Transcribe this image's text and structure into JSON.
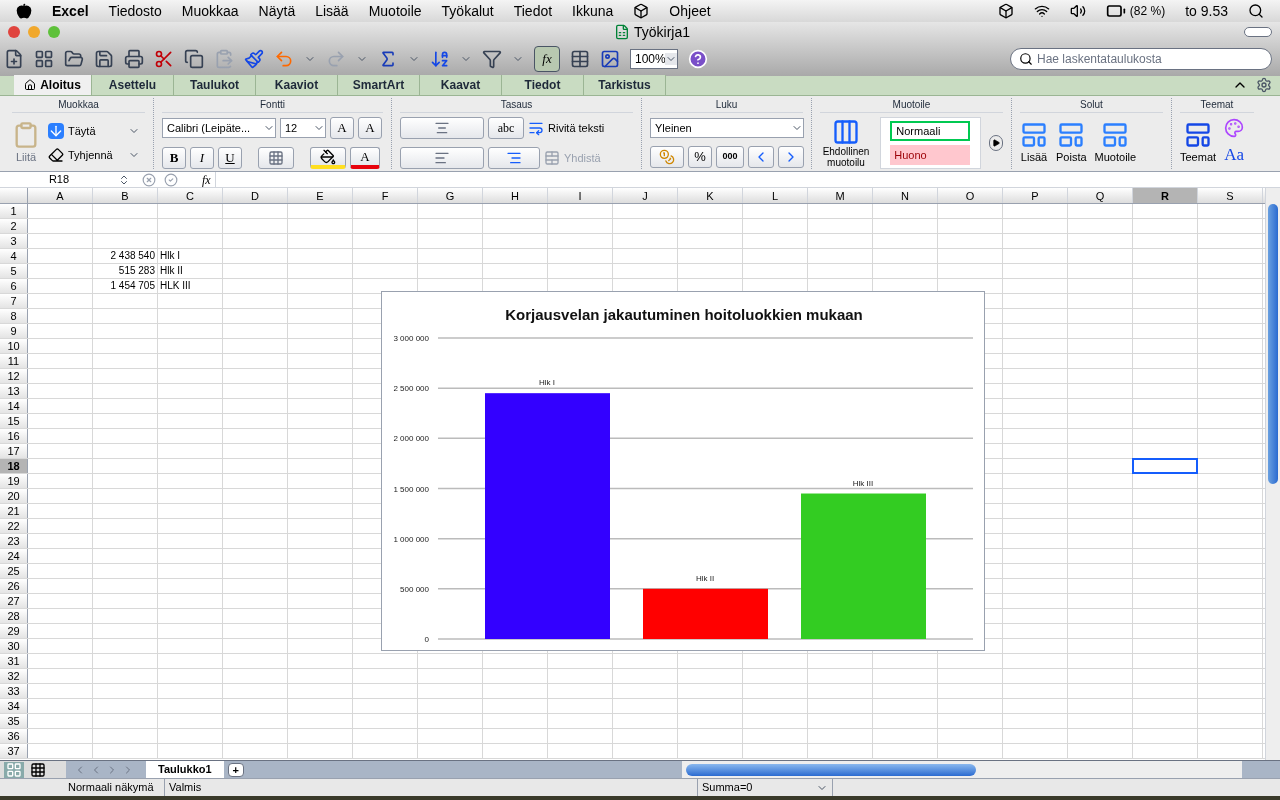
{
  "menubar": {
    "app": "Excel",
    "items": [
      "Tiedosto",
      "Muokkaa",
      "Näytä",
      "Lisää",
      "Muotoile",
      "Työkalut",
      "Tiedot",
      "Ikkuna",
      "Ohjeet"
    ],
    "battery": "(82 %)",
    "clock": "to 9.53"
  },
  "window": {
    "title": "Työkirja1"
  },
  "toolbar": {
    "zoom": "100%",
    "search_placeholder": "Hae laskentataulukosta",
    "formula_builder": "fx",
    "formula_builder_on": true
  },
  "ribbon_tabs": [
    {
      "label": "Aloitus",
      "selected": true
    },
    {
      "label": "Asettelu",
      "selected": false
    },
    {
      "label": "Taulukot",
      "selected": false
    },
    {
      "label": "Kaaviot",
      "selected": false
    },
    {
      "label": "SmartArt",
      "selected": false
    },
    {
      "label": "Kaavat",
      "selected": false
    },
    {
      "label": "Tiedot",
      "selected": false
    },
    {
      "label": "Tarkistus",
      "selected": false
    }
  ],
  "ribbon": {
    "muokkaa": {
      "title": "Muokkaa",
      "paste": "Liitä",
      "fill": "Täytä",
      "clear": "Tyhjennä"
    },
    "fontti": {
      "title": "Fontti",
      "font": "Calibri (Leipäte...",
      "size": "12",
      "bold": "B",
      "italic": "I",
      "underline": "U",
      "grow": "A",
      "shrink": "A",
      "font_color_letter": "A"
    },
    "tasaus": {
      "title": "Tasaus",
      "orientation": "abc",
      "wrap": "Rivitä teksti",
      "merge": "Yhdistä",
      "merge_disabled": true
    },
    "luku": {
      "title": "Luku",
      "format": "Yleinen",
      "percent": "%",
      "thousands": "000"
    },
    "muotoile": {
      "title": "Muotoile",
      "conditional": "Ehdollinen muotoilu",
      "styles": [
        {
          "label": "Normaali",
          "kind": "normal"
        },
        {
          "label": "Huono",
          "kind": "bad"
        }
      ]
    },
    "solut": {
      "title": "Solut",
      "buttons": [
        "Lisää",
        "Poista",
        "Muotoile"
      ]
    },
    "teemat": {
      "title": "Teemat",
      "themes": "Teemat",
      "fonts": "Aa"
    }
  },
  "formula_bar": {
    "name_box": "R18",
    "fx": "fx"
  },
  "columns": [
    {
      "label": "A",
      "selected": false
    },
    {
      "label": "B",
      "selected": false
    },
    {
      "label": "C",
      "selected": false
    },
    {
      "label": "D",
      "selected": false
    },
    {
      "label": "E",
      "selected": false
    },
    {
      "label": "F",
      "selected": false
    },
    {
      "label": "G",
      "selected": false
    },
    {
      "label": "H",
      "selected": false
    },
    {
      "label": "I",
      "selected": false
    },
    {
      "label": "J",
      "selected": false
    },
    {
      "label": "K",
      "selected": false
    },
    {
      "label": "L",
      "selected": false
    },
    {
      "label": "M",
      "selected": false
    },
    {
      "label": "N",
      "selected": false
    },
    {
      "label": "O",
      "selected": false
    },
    {
      "label": "P",
      "selected": false
    },
    {
      "label": "Q",
      "selected": false
    },
    {
      "label": "R",
      "selected": true
    },
    {
      "label": "S",
      "selected": false
    }
  ],
  "rows": [
    {
      "label": "1",
      "selected": false
    },
    {
      "label": "2",
      "selected": false
    },
    {
      "label": "3",
      "selected": false
    },
    {
      "label": "4",
      "selected": false,
      "cells": [
        "2 438 540",
        "Hlk I"
      ]
    },
    {
      "label": "5",
      "selected": false,
      "cells": [
        "515 283",
        "Hlk II"
      ]
    },
    {
      "label": "6",
      "selected": false,
      "cells": [
        "1 454 705",
        "HLK III"
      ]
    },
    {
      "label": "7",
      "selected": false
    },
    {
      "label": "8",
      "selected": false
    },
    {
      "label": "9",
      "selected": false
    },
    {
      "label": "10",
      "selected": false
    },
    {
      "label": "11",
      "selected": false
    },
    {
      "label": "12",
      "selected": false
    },
    {
      "label": "13",
      "selected": false
    },
    {
      "label": "14",
      "selected": false
    },
    {
      "label": "15",
      "selected": false
    },
    {
      "label": "16",
      "selected": false
    },
    {
      "label": "17",
      "selected": false
    },
    {
      "label": "18",
      "selected": true
    },
    {
      "label": "19",
      "selected": false
    },
    {
      "label": "20",
      "selected": false
    },
    {
      "label": "21",
      "selected": false
    },
    {
      "label": "22",
      "selected": false
    },
    {
      "label": "23",
      "selected": false
    },
    {
      "label": "24",
      "selected": false
    },
    {
      "label": "25",
      "selected": false
    },
    {
      "label": "26",
      "selected": false
    },
    {
      "label": "27",
      "selected": false
    },
    {
      "label": "28",
      "selected": false
    },
    {
      "label": "29",
      "selected": false
    },
    {
      "label": "30",
      "selected": false
    },
    {
      "label": "31",
      "selected": false
    },
    {
      "label": "32",
      "selected": false
    },
    {
      "label": "33",
      "selected": false
    },
    {
      "label": "34",
      "selected": false
    },
    {
      "label": "35",
      "selected": false
    },
    {
      "label": "36",
      "selected": false
    },
    {
      "label": "37",
      "selected": false
    }
  ],
  "chart": {
    "chart_data": {
      "type": "bar",
      "title": "Korjausvelan jakautuminen hoitoluokkien mukaan",
      "series": [
        {
          "name": "Hlk I",
          "color": "#3300ff",
          "values": [
            2450000
          ]
        },
        {
          "name": "Hlk II",
          "color": "#ff0000",
          "values": [
            500000
          ]
        },
        {
          "name": "Hlk III",
          "color": "#33cc22",
          "values": [
            1450000
          ]
        }
      ],
      "ylim": [
        0,
        3000000
      ],
      "yticks": [
        {
          "value": 0,
          "label": "0"
        },
        {
          "value": 500000,
          "label": "500 000"
        },
        {
          "value": 1000000,
          "label": "1 000 000"
        },
        {
          "value": 1500000,
          "label": "1 500 000"
        },
        {
          "value": 2000000,
          "label": "2 000 000"
        },
        {
          "value": 2500000,
          "label": "2 500 000"
        },
        {
          "value": 3000000,
          "label": "3 000 000"
        }
      ],
      "grid": true
    }
  },
  "sheet_tabs": [
    {
      "label": "Taulukko1",
      "selected": true
    }
  ],
  "add_sheet": "+",
  "status_bar": {
    "view": "Normaali näkymä",
    "state": "Valmis",
    "sum": "Summa=0"
  }
}
